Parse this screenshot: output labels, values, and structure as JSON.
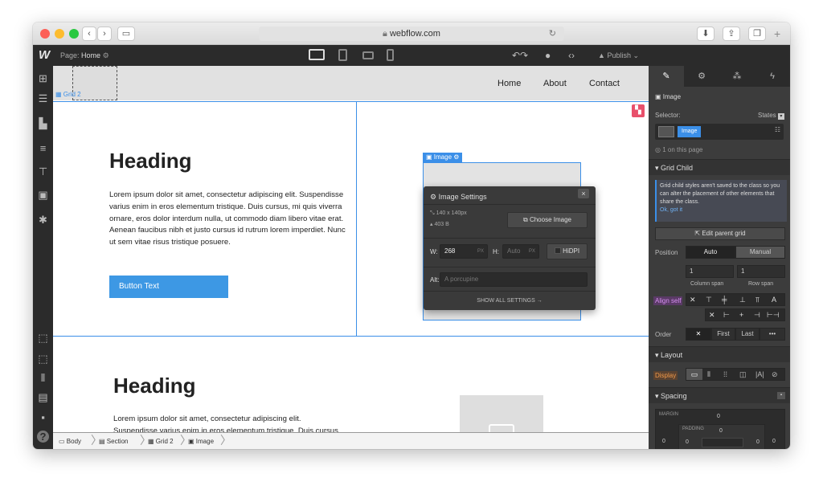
{
  "browser": {
    "url": "webflow.com"
  },
  "topbar": {
    "logo": "W",
    "page_label": "Page:",
    "page_name": "Home",
    "publish": "Publish"
  },
  "canvas": {
    "grid_tag": "Grid 2",
    "nav": {
      "items": [
        "Home",
        "About",
        "Contact"
      ]
    },
    "section1": {
      "heading": "Heading",
      "paragraph": "Lorem ipsum dolor sit amet, consectetur adipiscing elit. Suspendisse varius enim in eros elementum tristique. Duis cursus, mi quis viverra ornare, eros dolor interdum nulla, ut commodo diam libero vitae erat. Aenean faucibus nibh et justo cursus id rutrum lorem imperdiet. Nunc ut sem vitae risus tristique posuere.",
      "button": "Button Text",
      "image_tag": "Image"
    },
    "section2": {
      "heading": "Heading",
      "paragraph": "Lorem ipsum dolor sit amet, consectetur adipiscing elit. Suspendisse varius enim in eros elementum tristique. Duis cursus, mi quis viverra ornare, eros dolor interdum nulla, ut commodo diam libero vitae erat. Aenean faucibus nibh et justo"
    }
  },
  "popup": {
    "title": "Image Settings",
    "dims": "140 x 140px",
    "size": "403 B",
    "choose": "Choose Image",
    "w_label": "W:",
    "w_value": "268",
    "w_unit": "PX",
    "h_label": "H:",
    "h_value": "Auto",
    "h_unit": "PX",
    "hidpi": "HiDPI",
    "alt_label": "Alt:",
    "alt_placeholder": "A porcupine",
    "show_all": "SHOW ALL SETTINGS →"
  },
  "breadcrumbs": [
    "Body",
    "Section",
    "Grid 2",
    "Image"
  ],
  "panel": {
    "element": "Image",
    "selector_label": "Selector:",
    "states": "States",
    "selector_chip": "Image",
    "on_page": "1 on this page",
    "grid_child": {
      "title": "Grid Child",
      "note": "Grid child styles aren't saved to the class so you can alter the placement of other elements that share the class.",
      "got_it": "Ok, got it",
      "edit_parent": "Edit parent grid",
      "position_label": "Position",
      "position_options": [
        "Auto",
        "Manual"
      ],
      "column_value": "1",
      "row_value": "1",
      "column_label": "Column span",
      "row_label": "Row span",
      "align_label": "Align self",
      "order_label": "Order",
      "order_options": [
        "First",
        "Last",
        "•••"
      ]
    },
    "layout": {
      "title": "Layout",
      "display_label": "Display"
    },
    "spacing": {
      "title": "Spacing",
      "margin_label": "MARGIN",
      "padding_label": "PADDING",
      "margin_values": [
        "0",
        "0",
        "0",
        "0"
      ],
      "padding_values": [
        "0",
        "0",
        "0",
        "0"
      ]
    }
  },
  "colors": {
    "accent": "#3b8fe8",
    "panel": "#3c3c3c",
    "dark": "#2b2b2b",
    "button": "#3d98e4",
    "badge": "#e8506b",
    "align_label": "#d58ff0",
    "display_label": "#f29a4a"
  }
}
